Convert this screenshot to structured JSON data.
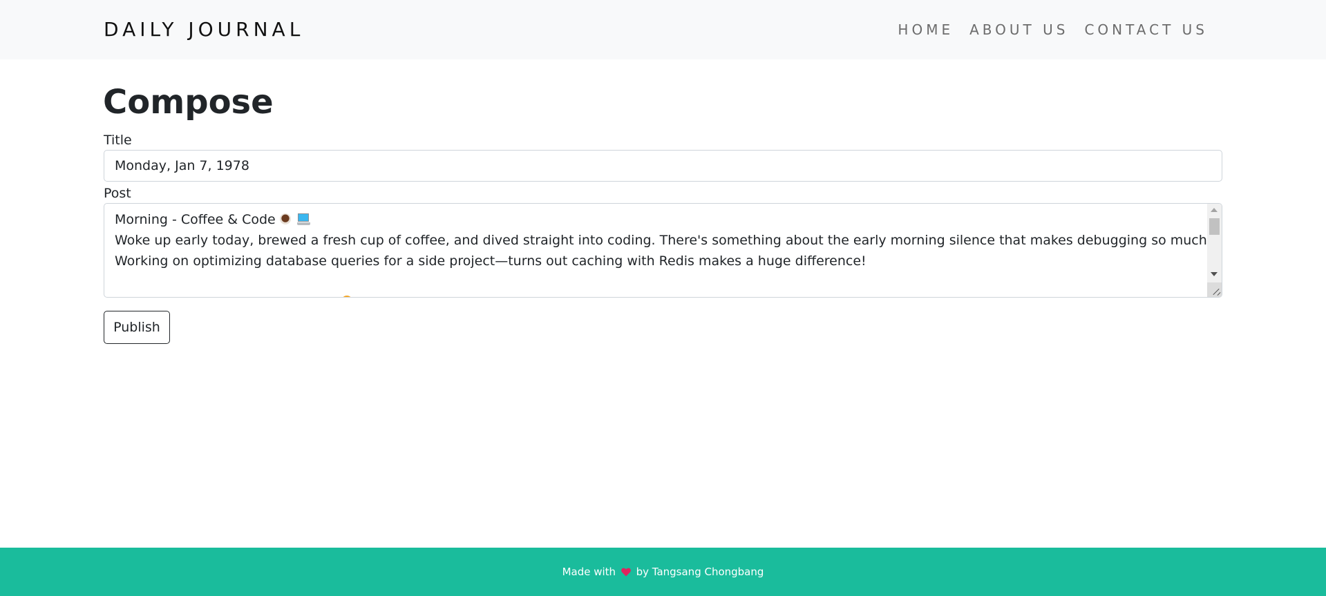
{
  "navbar": {
    "brand": "DAILY JOURNAL",
    "links": [
      "HOME",
      "ABOUT US",
      "CONTACT US"
    ]
  },
  "compose": {
    "heading": "Compose",
    "title_label": "Title",
    "title_value": "Monday, Jan 7, 1978",
    "post_label": "Post",
    "post_lines": [
      "Morning - Coffee & Code",
      "Woke up early today, brewed a fresh cup of coffee, and dived straight into coding. There's something about the early morning silence that makes debugging so much easier.",
      "Working on optimizing database queries for a side project—turns out caching with Redis makes a huge difference!"
    ],
    "post_icons": [
      "coffee-icon",
      "laptop-icon"
    ],
    "publish_label": "Publish"
  },
  "footer": {
    "prefix": "Made with",
    "icon": "heart-icon",
    "suffix": "by Tangsang Chongbang"
  },
  "colors": {
    "navbar_bg": "#f8f9fa",
    "footer_bg": "#1abc9c",
    "heart": "#e0245e"
  }
}
